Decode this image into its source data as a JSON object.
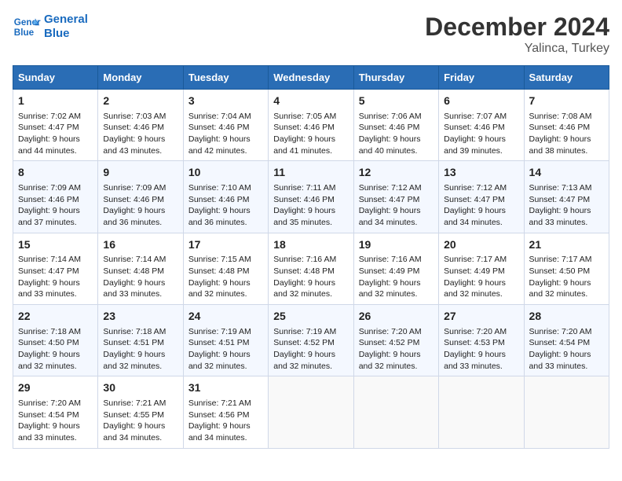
{
  "logo": {
    "line1": "General",
    "line2": "Blue"
  },
  "title": "December 2024",
  "subtitle": "Yalinca, Turkey",
  "headers": [
    "Sunday",
    "Monday",
    "Tuesday",
    "Wednesday",
    "Thursday",
    "Friday",
    "Saturday"
  ],
  "weeks": [
    [
      {
        "day": "1",
        "sunrise": "7:02 AM",
        "sunset": "4:47 PM",
        "daylight": "9 hours and 44 minutes."
      },
      {
        "day": "2",
        "sunrise": "7:03 AM",
        "sunset": "4:46 PM",
        "daylight": "9 hours and 43 minutes."
      },
      {
        "day": "3",
        "sunrise": "7:04 AM",
        "sunset": "4:46 PM",
        "daylight": "9 hours and 42 minutes."
      },
      {
        "day": "4",
        "sunrise": "7:05 AM",
        "sunset": "4:46 PM",
        "daylight": "9 hours and 41 minutes."
      },
      {
        "day": "5",
        "sunrise": "7:06 AM",
        "sunset": "4:46 PM",
        "daylight": "9 hours and 40 minutes."
      },
      {
        "day": "6",
        "sunrise": "7:07 AM",
        "sunset": "4:46 PM",
        "daylight": "9 hours and 39 minutes."
      },
      {
        "day": "7",
        "sunrise": "7:08 AM",
        "sunset": "4:46 PM",
        "daylight": "9 hours and 38 minutes."
      }
    ],
    [
      {
        "day": "8",
        "sunrise": "7:09 AM",
        "sunset": "4:46 PM",
        "daylight": "9 hours and 37 minutes."
      },
      {
        "day": "9",
        "sunrise": "7:09 AM",
        "sunset": "4:46 PM",
        "daylight": "9 hours and 36 minutes."
      },
      {
        "day": "10",
        "sunrise": "7:10 AM",
        "sunset": "4:46 PM",
        "daylight": "9 hours and 36 minutes."
      },
      {
        "day": "11",
        "sunrise": "7:11 AM",
        "sunset": "4:46 PM",
        "daylight": "9 hours and 35 minutes."
      },
      {
        "day": "12",
        "sunrise": "7:12 AM",
        "sunset": "4:47 PM",
        "daylight": "9 hours and 34 minutes."
      },
      {
        "day": "13",
        "sunrise": "7:12 AM",
        "sunset": "4:47 PM",
        "daylight": "9 hours and 34 minutes."
      },
      {
        "day": "14",
        "sunrise": "7:13 AM",
        "sunset": "4:47 PM",
        "daylight": "9 hours and 33 minutes."
      }
    ],
    [
      {
        "day": "15",
        "sunrise": "7:14 AM",
        "sunset": "4:47 PM",
        "daylight": "9 hours and 33 minutes."
      },
      {
        "day": "16",
        "sunrise": "7:14 AM",
        "sunset": "4:48 PM",
        "daylight": "9 hours and 33 minutes."
      },
      {
        "day": "17",
        "sunrise": "7:15 AM",
        "sunset": "4:48 PM",
        "daylight": "9 hours and 32 minutes."
      },
      {
        "day": "18",
        "sunrise": "7:16 AM",
        "sunset": "4:48 PM",
        "daylight": "9 hours and 32 minutes."
      },
      {
        "day": "19",
        "sunrise": "7:16 AM",
        "sunset": "4:49 PM",
        "daylight": "9 hours and 32 minutes."
      },
      {
        "day": "20",
        "sunrise": "7:17 AM",
        "sunset": "4:49 PM",
        "daylight": "9 hours and 32 minutes."
      },
      {
        "day": "21",
        "sunrise": "7:17 AM",
        "sunset": "4:50 PM",
        "daylight": "9 hours and 32 minutes."
      }
    ],
    [
      {
        "day": "22",
        "sunrise": "7:18 AM",
        "sunset": "4:50 PM",
        "daylight": "9 hours and 32 minutes."
      },
      {
        "day": "23",
        "sunrise": "7:18 AM",
        "sunset": "4:51 PM",
        "daylight": "9 hours and 32 minutes."
      },
      {
        "day": "24",
        "sunrise": "7:19 AM",
        "sunset": "4:51 PM",
        "daylight": "9 hours and 32 minutes."
      },
      {
        "day": "25",
        "sunrise": "7:19 AM",
        "sunset": "4:52 PM",
        "daylight": "9 hours and 32 minutes."
      },
      {
        "day": "26",
        "sunrise": "7:20 AM",
        "sunset": "4:52 PM",
        "daylight": "9 hours and 32 minutes."
      },
      {
        "day": "27",
        "sunrise": "7:20 AM",
        "sunset": "4:53 PM",
        "daylight": "9 hours and 33 minutes."
      },
      {
        "day": "28",
        "sunrise": "7:20 AM",
        "sunset": "4:54 PM",
        "daylight": "9 hours and 33 minutes."
      }
    ],
    [
      {
        "day": "29",
        "sunrise": "7:20 AM",
        "sunset": "4:54 PM",
        "daylight": "9 hours and 33 minutes."
      },
      {
        "day": "30",
        "sunrise": "7:21 AM",
        "sunset": "4:55 PM",
        "daylight": "9 hours and 34 minutes."
      },
      {
        "day": "31",
        "sunrise": "7:21 AM",
        "sunset": "4:56 PM",
        "daylight": "9 hours and 34 minutes."
      },
      null,
      null,
      null,
      null
    ]
  ],
  "labels": {
    "sunrise": "Sunrise:",
    "sunset": "Sunset:",
    "daylight": "Daylight:"
  }
}
